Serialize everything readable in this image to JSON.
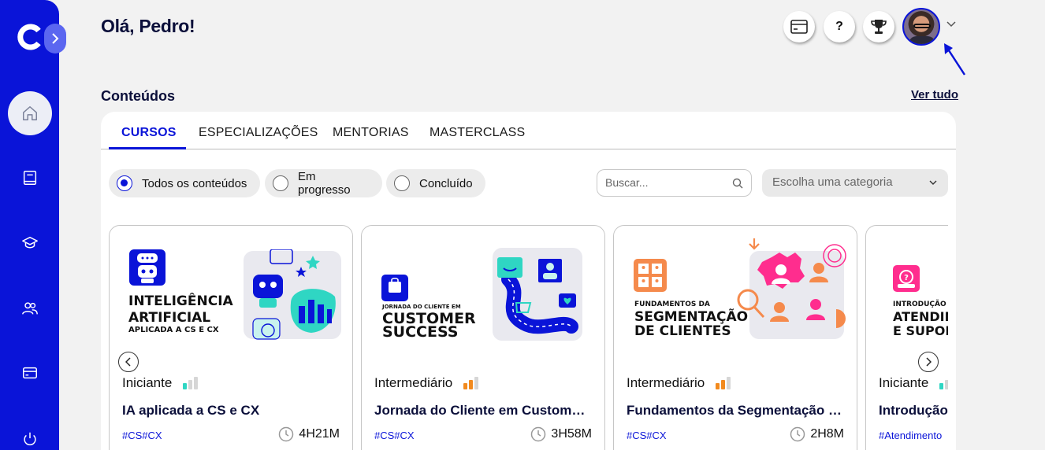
{
  "header": {
    "greeting": "Olá, Pedro!",
    "icons": [
      "credit-card-icon",
      "help-icon",
      "trophy-icon"
    ],
    "help_label": "?"
  },
  "sidebar": {
    "items": [
      "home-icon",
      "book-icon",
      "graduation-cap-icon",
      "users-icon",
      "credit-card-icon",
      "power-icon"
    ]
  },
  "content": {
    "title": "Conteúdos",
    "see_all": "Ver tudo",
    "tabs": [
      {
        "label": "CURSOS",
        "active": true
      },
      {
        "label": "ESPECIALIZAÇÕES",
        "active": false
      },
      {
        "label": "MENTORIAS",
        "active": false
      },
      {
        "label": "MASTERCLASS",
        "active": false
      }
    ],
    "filters": [
      {
        "label": "Todos os conteúdos",
        "selected": true
      },
      {
        "label": "Em progresso",
        "selected": false
      },
      {
        "label": "Concluído",
        "selected": false
      }
    ],
    "search_placeholder": "Buscar...",
    "category_placeholder": "Escolha uma categoria"
  },
  "cards": [
    {
      "thumb_lines": [
        "INTELIGÊNCIA",
        "ARTIFICIAL",
        "APLICADA A CS E CX"
      ],
      "level": "Iniciante",
      "level_bars": 1,
      "level_color": "#2fd6c3",
      "title": "IA aplicada a CS e CX",
      "tags": "#CS#CX",
      "duration": "4H21M"
    },
    {
      "thumb_lines": [
        "JORNADA DO CLIENTE EM",
        "CUSTOMER",
        "SUCCESS"
      ],
      "level": "Intermediário",
      "level_bars": 2,
      "level_color": "#f28a1e",
      "title": "Jornada do Cliente em Customer Success",
      "tags": "#CS#CX",
      "duration": "3H58M"
    },
    {
      "thumb_lines": [
        "FUNDAMENTOS DA",
        "SEGMENTAÇÃO",
        "DE CLIENTES"
      ],
      "level": "Intermediário",
      "level_bars": 2,
      "level_color": "#f28a1e",
      "title": "Fundamentos da Segmentação de Clientes",
      "tags": "#CS#CX",
      "duration": "2H8M"
    },
    {
      "thumb_lines": [
        "INTRODUÇÃO A",
        "ATENDIMENTO",
        "E SUPORTE"
      ],
      "level": "Iniciante",
      "level_bars": 1,
      "level_color": "#2fd6c3",
      "title": "Introdução ao Atendimento e Suporte",
      "tags": "#Atendimento",
      "duration": ""
    }
  ],
  "colors": {
    "brand": "#0a14d8",
    "heading": "#0b0f3a"
  }
}
